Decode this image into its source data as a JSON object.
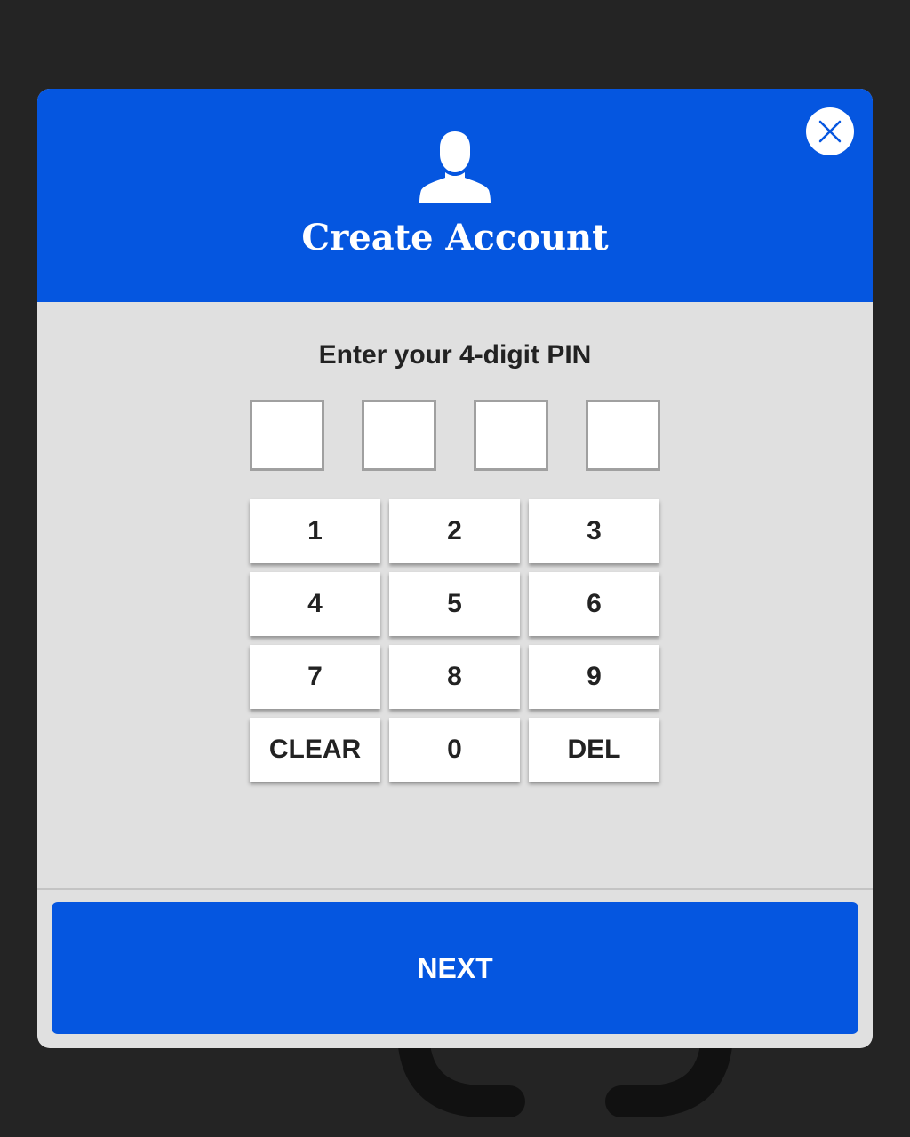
{
  "header": {
    "title": "Create Account",
    "icon": "user-icon",
    "close_icon": "close-icon"
  },
  "pin": {
    "prompt": "Enter your 4-digit PIN",
    "length": 4,
    "digits": [
      "",
      "",
      "",
      ""
    ]
  },
  "keypad": {
    "keys": [
      {
        "label": "1",
        "name": "key-1"
      },
      {
        "label": "2",
        "name": "key-2"
      },
      {
        "label": "3",
        "name": "key-3"
      },
      {
        "label": "4",
        "name": "key-4"
      },
      {
        "label": "5",
        "name": "key-5"
      },
      {
        "label": "6",
        "name": "key-6"
      },
      {
        "label": "7",
        "name": "key-7"
      },
      {
        "label": "8",
        "name": "key-8"
      },
      {
        "label": "9",
        "name": "key-9"
      },
      {
        "label": "CLEAR",
        "name": "key-clear"
      },
      {
        "label": "0",
        "name": "key-0"
      },
      {
        "label": "DEL",
        "name": "key-del"
      }
    ]
  },
  "footer": {
    "next_label": "NEXT"
  },
  "colors": {
    "primary": "#0556e0",
    "panel": "#e0e0e0",
    "backdrop": "#242424"
  }
}
